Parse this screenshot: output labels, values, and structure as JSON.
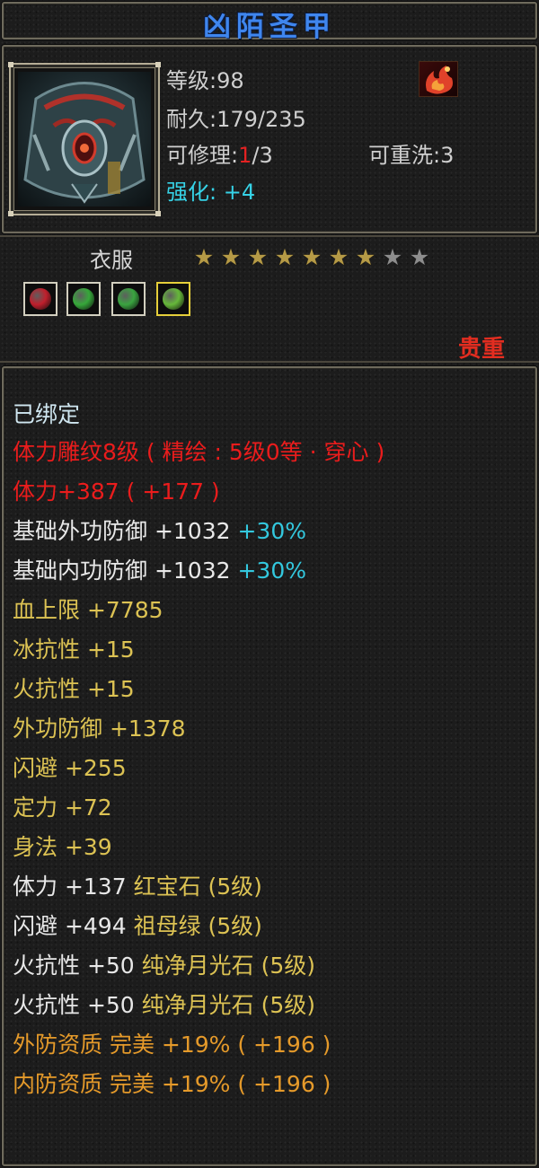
{
  "title": "凶陌圣甲",
  "header": {
    "level_label": "等级",
    "level_value": "98",
    "durability_label": "耐久",
    "durability_value": "179/235",
    "repair_label": "可修理",
    "repair_used": "1",
    "repair_total": "/3",
    "rewash_label": "可重洗",
    "rewash_value": "3",
    "enhance_label": "强化",
    "enhance_value": "+4",
    "separator": ":"
  },
  "item": {
    "type": "衣服",
    "stars_total": 9,
    "stars_lit": 7,
    "gem_slots": [
      {
        "name": "ruby-gem",
        "color": "#c01f2c"
      },
      {
        "name": "emerald-gem",
        "color": "#36a83a"
      },
      {
        "name": "emerald-gem",
        "color": "#3aa440"
      },
      {
        "name": "emerald-gem",
        "color": "#66b83a"
      }
    ],
    "rarity": "贵重"
  },
  "stats": [
    {
      "parts": [
        {
          "text": "已绑定",
          "color": "lightcyan"
        }
      ]
    },
    {
      "parts": [
        {
          "text": "体力雕纹8级 ( 精绘 : 5级0等 · 穿心 )",
          "color": "red"
        }
      ]
    },
    {
      "parts": [
        {
          "text": "体力+387 ( +177 )",
          "color": "red"
        }
      ]
    },
    {
      "parts": [
        {
          "text": "基础外功防御 +1032 ",
          "color": "white"
        },
        {
          "text": "+30%",
          "color": "cyan"
        }
      ]
    },
    {
      "parts": [
        {
          "text": "基础内功防御 +1032 ",
          "color": "white"
        },
        {
          "text": "+30%",
          "color": "cyan"
        }
      ]
    },
    {
      "parts": [
        {
          "text": "血上限 +7785",
          "color": "yellow"
        }
      ]
    },
    {
      "parts": [
        {
          "text": "冰抗性 +15",
          "color": "yellow"
        }
      ]
    },
    {
      "parts": [
        {
          "text": "火抗性 +15",
          "color": "yellow"
        }
      ]
    },
    {
      "parts": [
        {
          "text": "外功防御 +1378",
          "color": "yellow"
        }
      ]
    },
    {
      "parts": [
        {
          "text": "闪避 +255",
          "color": "yellow"
        }
      ]
    },
    {
      "parts": [
        {
          "text": "定力 +72",
          "color": "yellow"
        }
      ]
    },
    {
      "parts": [
        {
          "text": "身法 +39",
          "color": "yellow"
        }
      ]
    },
    {
      "parts": [
        {
          "text": "体力 +137 ",
          "color": "white"
        },
        {
          "text": "红宝石 (5级)",
          "color": "yellow"
        }
      ]
    },
    {
      "parts": [
        {
          "text": "闪避 +494 ",
          "color": "white"
        },
        {
          "text": "祖母绿 (5级)",
          "color": "yellow"
        }
      ]
    },
    {
      "parts": [
        {
          "text": "火抗性 +50 ",
          "color": "white"
        },
        {
          "text": "纯净月光石 (5级)",
          "color": "yellow"
        }
      ]
    },
    {
      "parts": [
        {
          "text": "火抗性 +50 ",
          "color": "white"
        },
        {
          "text": "纯净月光石 (5级)",
          "color": "yellow"
        }
      ]
    },
    {
      "parts": [
        {
          "text": "外防资质  完美 +19% ( +196 )",
          "color": "orange"
        }
      ]
    },
    {
      "parts": [
        {
          "text": "内防资质  完美 +19% ( +196 )",
          "color": "orange"
        }
      ]
    }
  ],
  "colors": {
    "white": "#e8e8e8",
    "red": "#ea1c1c",
    "yellow": "#dcc253",
    "orange": "#e59a2a",
    "cyan": "#33c8de",
    "lightcyan": "#cfe6f0",
    "star_lit": "#b59a46",
    "star_dim": "#8d8d8d"
  }
}
